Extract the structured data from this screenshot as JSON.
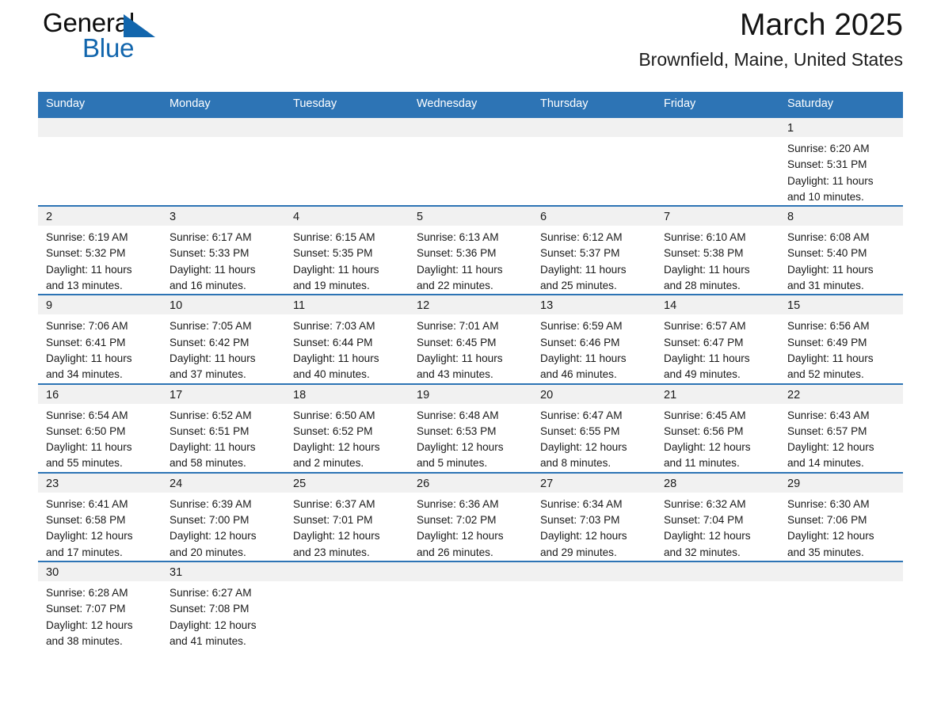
{
  "brand": {
    "name_part1": "General",
    "name_part2": "Blue",
    "flag_icon": "blue-triangle-flag-icon",
    "color_black": "#0d0d0d",
    "color_blue": "#1266ad"
  },
  "header": {
    "month_title": "March 2025",
    "location": "Brownfield, Maine, United States"
  },
  "theme": {
    "header_row_bg": "#2d74b5",
    "day_number_bg": "#f1f1f1",
    "rule_color": "#2d74b5"
  },
  "weekday_headers": [
    "Sunday",
    "Monday",
    "Tuesday",
    "Wednesday",
    "Thursday",
    "Friday",
    "Saturday"
  ],
  "labels": {
    "sunrise_prefix": "Sunrise:",
    "sunset_prefix": "Sunset:",
    "daylight_prefix": "Daylight:"
  },
  "weeks": [
    [
      {
        "day": "",
        "empty": true
      },
      {
        "day": "",
        "empty": true
      },
      {
        "day": "",
        "empty": true
      },
      {
        "day": "",
        "empty": true
      },
      {
        "day": "",
        "empty": true
      },
      {
        "day": "",
        "empty": true
      },
      {
        "day": "1",
        "sunrise": "Sunrise: 6:20 AM",
        "sunset": "Sunset: 5:31 PM",
        "daylight_l1": "Daylight: 11 hours",
        "daylight_l2": "and 10 minutes."
      }
    ],
    [
      {
        "day": "2",
        "sunrise": "Sunrise: 6:19 AM",
        "sunset": "Sunset: 5:32 PM",
        "daylight_l1": "Daylight: 11 hours",
        "daylight_l2": "and 13 minutes."
      },
      {
        "day": "3",
        "sunrise": "Sunrise: 6:17 AM",
        "sunset": "Sunset: 5:33 PM",
        "daylight_l1": "Daylight: 11 hours",
        "daylight_l2": "and 16 minutes."
      },
      {
        "day": "4",
        "sunrise": "Sunrise: 6:15 AM",
        "sunset": "Sunset: 5:35 PM",
        "daylight_l1": "Daylight: 11 hours",
        "daylight_l2": "and 19 minutes."
      },
      {
        "day": "5",
        "sunrise": "Sunrise: 6:13 AM",
        "sunset": "Sunset: 5:36 PM",
        "daylight_l1": "Daylight: 11 hours",
        "daylight_l2": "and 22 minutes."
      },
      {
        "day": "6",
        "sunrise": "Sunrise: 6:12 AM",
        "sunset": "Sunset: 5:37 PM",
        "daylight_l1": "Daylight: 11 hours",
        "daylight_l2": "and 25 minutes."
      },
      {
        "day": "7",
        "sunrise": "Sunrise: 6:10 AM",
        "sunset": "Sunset: 5:38 PM",
        "daylight_l1": "Daylight: 11 hours",
        "daylight_l2": "and 28 minutes."
      },
      {
        "day": "8",
        "sunrise": "Sunrise: 6:08 AM",
        "sunset": "Sunset: 5:40 PM",
        "daylight_l1": "Daylight: 11 hours",
        "daylight_l2": "and 31 minutes."
      }
    ],
    [
      {
        "day": "9",
        "sunrise": "Sunrise: 7:06 AM",
        "sunset": "Sunset: 6:41 PM",
        "daylight_l1": "Daylight: 11 hours",
        "daylight_l2": "and 34 minutes."
      },
      {
        "day": "10",
        "sunrise": "Sunrise: 7:05 AM",
        "sunset": "Sunset: 6:42 PM",
        "daylight_l1": "Daylight: 11 hours",
        "daylight_l2": "and 37 minutes."
      },
      {
        "day": "11",
        "sunrise": "Sunrise: 7:03 AM",
        "sunset": "Sunset: 6:44 PM",
        "daylight_l1": "Daylight: 11 hours",
        "daylight_l2": "and 40 minutes."
      },
      {
        "day": "12",
        "sunrise": "Sunrise: 7:01 AM",
        "sunset": "Sunset: 6:45 PM",
        "daylight_l1": "Daylight: 11 hours",
        "daylight_l2": "and 43 minutes."
      },
      {
        "day": "13",
        "sunrise": "Sunrise: 6:59 AM",
        "sunset": "Sunset: 6:46 PM",
        "daylight_l1": "Daylight: 11 hours",
        "daylight_l2": "and 46 minutes."
      },
      {
        "day": "14",
        "sunrise": "Sunrise: 6:57 AM",
        "sunset": "Sunset: 6:47 PM",
        "daylight_l1": "Daylight: 11 hours",
        "daylight_l2": "and 49 minutes."
      },
      {
        "day": "15",
        "sunrise": "Sunrise: 6:56 AM",
        "sunset": "Sunset: 6:49 PM",
        "daylight_l1": "Daylight: 11 hours",
        "daylight_l2": "and 52 minutes."
      }
    ],
    [
      {
        "day": "16",
        "sunrise": "Sunrise: 6:54 AM",
        "sunset": "Sunset: 6:50 PM",
        "daylight_l1": "Daylight: 11 hours",
        "daylight_l2": "and 55 minutes."
      },
      {
        "day": "17",
        "sunrise": "Sunrise: 6:52 AM",
        "sunset": "Sunset: 6:51 PM",
        "daylight_l1": "Daylight: 11 hours",
        "daylight_l2": "and 58 minutes."
      },
      {
        "day": "18",
        "sunrise": "Sunrise: 6:50 AM",
        "sunset": "Sunset: 6:52 PM",
        "daylight_l1": "Daylight: 12 hours",
        "daylight_l2": "and 2 minutes."
      },
      {
        "day": "19",
        "sunrise": "Sunrise: 6:48 AM",
        "sunset": "Sunset: 6:53 PM",
        "daylight_l1": "Daylight: 12 hours",
        "daylight_l2": "and 5 minutes."
      },
      {
        "day": "20",
        "sunrise": "Sunrise: 6:47 AM",
        "sunset": "Sunset: 6:55 PM",
        "daylight_l1": "Daylight: 12 hours",
        "daylight_l2": "and 8 minutes."
      },
      {
        "day": "21",
        "sunrise": "Sunrise: 6:45 AM",
        "sunset": "Sunset: 6:56 PM",
        "daylight_l1": "Daylight: 12 hours",
        "daylight_l2": "and 11 minutes."
      },
      {
        "day": "22",
        "sunrise": "Sunrise: 6:43 AM",
        "sunset": "Sunset: 6:57 PM",
        "daylight_l1": "Daylight: 12 hours",
        "daylight_l2": "and 14 minutes."
      }
    ],
    [
      {
        "day": "23",
        "sunrise": "Sunrise: 6:41 AM",
        "sunset": "Sunset: 6:58 PM",
        "daylight_l1": "Daylight: 12 hours",
        "daylight_l2": "and 17 minutes."
      },
      {
        "day": "24",
        "sunrise": "Sunrise: 6:39 AM",
        "sunset": "Sunset: 7:00 PM",
        "daylight_l1": "Daylight: 12 hours",
        "daylight_l2": "and 20 minutes."
      },
      {
        "day": "25",
        "sunrise": "Sunrise: 6:37 AM",
        "sunset": "Sunset: 7:01 PM",
        "daylight_l1": "Daylight: 12 hours",
        "daylight_l2": "and 23 minutes."
      },
      {
        "day": "26",
        "sunrise": "Sunrise: 6:36 AM",
        "sunset": "Sunset: 7:02 PM",
        "daylight_l1": "Daylight: 12 hours",
        "daylight_l2": "and 26 minutes."
      },
      {
        "day": "27",
        "sunrise": "Sunrise: 6:34 AM",
        "sunset": "Sunset: 7:03 PM",
        "daylight_l1": "Daylight: 12 hours",
        "daylight_l2": "and 29 minutes."
      },
      {
        "day": "28",
        "sunrise": "Sunrise: 6:32 AM",
        "sunset": "Sunset: 7:04 PM",
        "daylight_l1": "Daylight: 12 hours",
        "daylight_l2": "and 32 minutes."
      },
      {
        "day": "29",
        "sunrise": "Sunrise: 6:30 AM",
        "sunset": "Sunset: 7:06 PM",
        "daylight_l1": "Daylight: 12 hours",
        "daylight_l2": "and 35 minutes."
      }
    ],
    [
      {
        "day": "30",
        "sunrise": "Sunrise: 6:28 AM",
        "sunset": "Sunset: 7:07 PM",
        "daylight_l1": "Daylight: 12 hours",
        "daylight_l2": "and 38 minutes."
      },
      {
        "day": "31",
        "sunrise": "Sunrise: 6:27 AM",
        "sunset": "Sunset: 7:08 PM",
        "daylight_l1": "Daylight: 12 hours",
        "daylight_l2": "and 41 minutes."
      },
      {
        "day": "",
        "empty": true
      },
      {
        "day": "",
        "empty": true
      },
      {
        "day": "",
        "empty": true
      },
      {
        "day": "",
        "empty": true
      },
      {
        "day": "",
        "empty": true
      }
    ]
  ]
}
